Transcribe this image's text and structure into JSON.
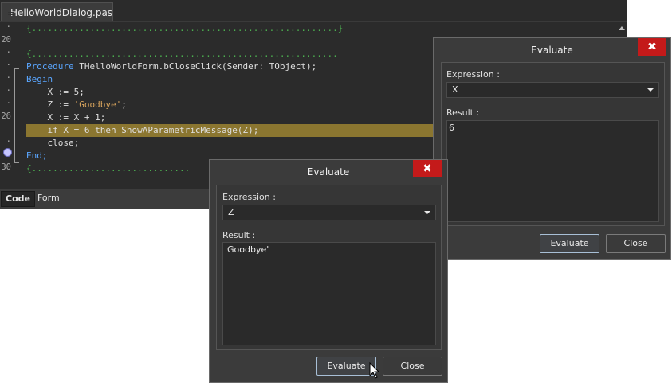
{
  "editor": {
    "file_tab": "HelloWorldDialog.pas",
    "line_numbers": {
      "l20": "20",
      "l26": "26",
      "l30": "30"
    },
    "lines": {
      "l0": "{..........................................................}",
      "l2": "{..........................................................",
      "l3_kw": "Procedure",
      "l3_rest": " THelloWorldForm.bCloseClick(Sender: TObject);",
      "l4": "Begin",
      "l5": "    X := 5;",
      "l6_a": "    Z := ",
      "l6_str": "'Goodbye'",
      "l6_b": ";",
      "l7": "    X := X + 1;",
      "l8": "    if X = 6 then ShowAParametricMessage(Z);",
      "l9": "    close;",
      "l10": "End;",
      "l11": "{.............................."
    },
    "bottom_tabs": [
      "Code",
      "Form"
    ]
  },
  "dialog_x": {
    "title": "Evaluate",
    "close_glyph": "✖",
    "expression_label": "Expression :",
    "expression_value": "X",
    "result_label": "Result :",
    "result_value": "6",
    "evaluate_button": "Evaluate",
    "close_button": "Close"
  },
  "dialog_z": {
    "title": "Evaluate",
    "close_glyph": "✖",
    "expression_label": "Expression :",
    "expression_value": "Z",
    "result_label": "Result :",
    "result_value": "'Goodbye'",
    "evaluate_button": "Evaluate",
    "close_button": "Close"
  },
  "colors": {
    "editor_bg": "#2b2b2b",
    "keyword": "#5aa6ff",
    "string": "#d7a35c",
    "comment": "#4caf50",
    "highlight": "#8b7630",
    "close_red": "#c41a1a"
  }
}
